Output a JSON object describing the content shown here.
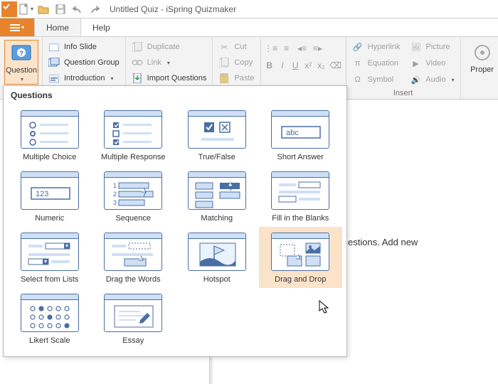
{
  "title": "Untitled Quiz - iSpring Quizmaker",
  "tabs": {
    "home": "Home",
    "help": "Help"
  },
  "ribbon": {
    "question": "Question",
    "infoSlide": "Info Slide",
    "questionGroup": "Question Group",
    "introduction": "Introduction",
    "duplicate": "Duplicate",
    "link": "Link",
    "importQuestions": "Import Questions",
    "cut": "Cut",
    "copy": "Copy",
    "paste": "Paste",
    "hyperlink": "Hyperlink",
    "equation": "Equation",
    "symbol": "Symbol",
    "picture": "Picture",
    "video": "Video",
    "audio": "Audio",
    "proper": "Proper",
    "insert": "Insert"
  },
  "dropdown": {
    "header": "Questions",
    "items": [
      {
        "label": "Multiple Choice"
      },
      {
        "label": "Multiple Response"
      },
      {
        "label": "True/False"
      },
      {
        "label": "Short Answer"
      },
      {
        "label": "Numeric"
      },
      {
        "label": "Sequence"
      },
      {
        "label": "Matching"
      },
      {
        "label": "Fill in the Blanks"
      },
      {
        "label": "Select from Lists"
      },
      {
        "label": "Drag the Words"
      },
      {
        "label": "Hotspot"
      },
      {
        "label": "Drag and Drop"
      },
      {
        "label": "Likert Scale"
      },
      {
        "label": "Essay"
      }
    ]
  },
  "content": {
    "empty": "uiz has no questions. Add new"
  }
}
